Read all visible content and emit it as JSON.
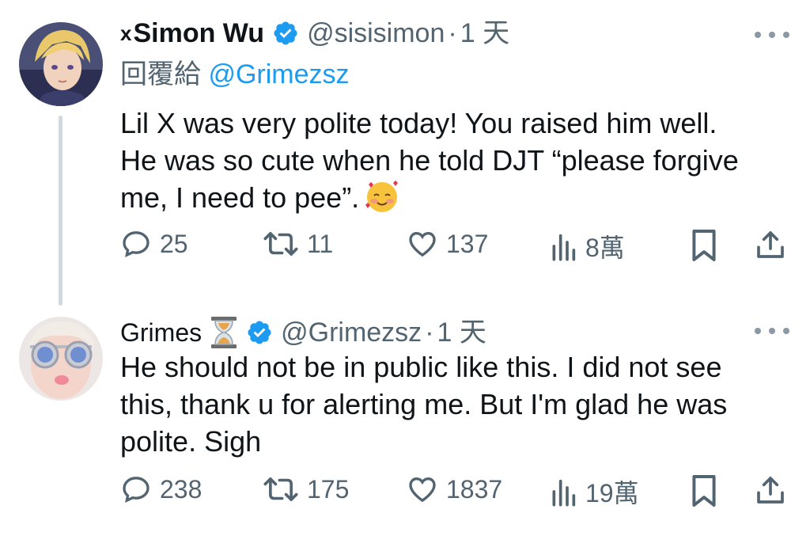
{
  "tweets": [
    {
      "name": "Simon Wu",
      "x_mark": "x",
      "handle": "@sisisimon",
      "dot": "·",
      "time": "1 天",
      "reply_prefix": "回覆給",
      "reply_mention": "@Grimezsz",
      "lines": [
        "Lil X was very polite today!  You raised him well.",
        "He was so cute when he told DJT “please forgive",
        "me, I need to pee”."
      ],
      "emoji": "smiling-face-with-hearts",
      "replies": "25",
      "reposts": "11",
      "likes": "137",
      "views": "8萬"
    },
    {
      "name": "Grimes",
      "handle": "@Grimezsz",
      "dot": "·",
      "time": "1 天",
      "badge_icon": "hourglass-icon",
      "lines": [
        "He should not be in public like this.  I did not see",
        "this, thank u for alerting me.  But I'm glad he was",
        "polite.  Sigh"
      ],
      "replies": "238",
      "reposts": "175",
      "likes": "1837",
      "views": "19萬"
    }
  ],
  "colors": {
    "text": "#0f1419",
    "secondary": "#536471",
    "link": "#1d9bf0",
    "verified": "#1d9bf0",
    "thread_line": "#cfd9de"
  }
}
